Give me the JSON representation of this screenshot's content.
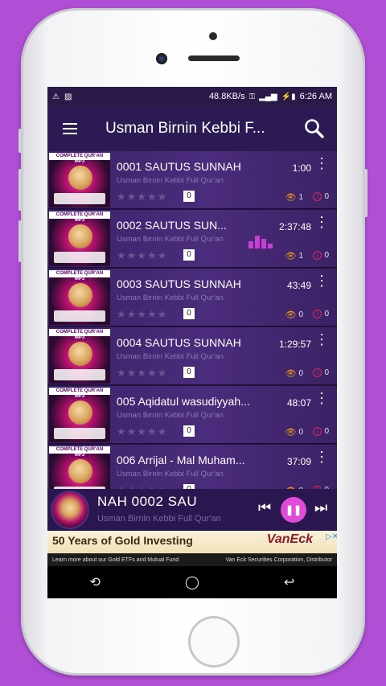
{
  "status_bar": {
    "speed": "48.8KB/s",
    "time": "6:26 AM"
  },
  "app_bar": {
    "title": "Usman Birnin Kebbi F..."
  },
  "thumbnail": {
    "banner": "COMPLETE QUR'AN ONLINE",
    "sub": "MP3"
  },
  "tracks": [
    {
      "title": "0001 SAUTUS SUNNAH",
      "artist": "Usman Birnin Kebbi Full Qur'an",
      "duration": "1:00",
      "rating_count": "0",
      "views": "1",
      "likes": "0",
      "playing": false
    },
    {
      "title": "0002 SAUTUS SUN...",
      "artist": "Usman Birnin Kebbi Full Qur'an",
      "duration": "2:37:48",
      "rating_count": "0",
      "views": "1",
      "likes": "0",
      "playing": true
    },
    {
      "title": "0003 SAUTUS SUNNAH",
      "artist": "Usman Birnin Kebbi Full Qur'an",
      "duration": "43:49",
      "rating_count": "0",
      "views": "0",
      "likes": "0",
      "playing": false
    },
    {
      "title": "0004 SAUTUS SUNNAH",
      "artist": "Usman Birnin Kebbi Full Qur'an",
      "duration": "1:29:57",
      "rating_count": "0",
      "views": "0",
      "likes": "0",
      "playing": false
    },
    {
      "title": "005 Aqidatul wasudiyyah...",
      "artist": "Usman Birnin Kebbi Full Qur'an",
      "duration": "48:07",
      "rating_count": "0",
      "views": "0",
      "likes": "0",
      "playing": false
    },
    {
      "title": "006 Arrijal - Mal Muham...",
      "artist": "Usman Birnin Kebbi Full Qur'an",
      "duration": "37:09",
      "rating_count": "0",
      "views": "0",
      "likes": "0",
      "playing": false
    }
  ],
  "player": {
    "title": "NAH          0002 SAU",
    "artist": "Usman Birnin Kebbi Full Qur'an",
    "state": "playing"
  },
  "ad": {
    "headline": "50 Years of Gold Investing",
    "brand": "VanEck",
    "foot_left": "Learn more about our Gold ETFs and Mutual Fund",
    "foot_right": "Van Eck Securities Corporation, Distributor"
  },
  "icons": {
    "menu": "hamburger-icon",
    "search": "search-icon",
    "more": "more-vert-icon",
    "views": "eye-icon",
    "likes": "info-icon",
    "prev": "skip-previous-icon",
    "pause": "pause-icon",
    "next": "skip-next-icon"
  },
  "colors": {
    "app_bar": "#2c1a55",
    "accent": "#e14ad7",
    "background": "#b04fd6"
  }
}
